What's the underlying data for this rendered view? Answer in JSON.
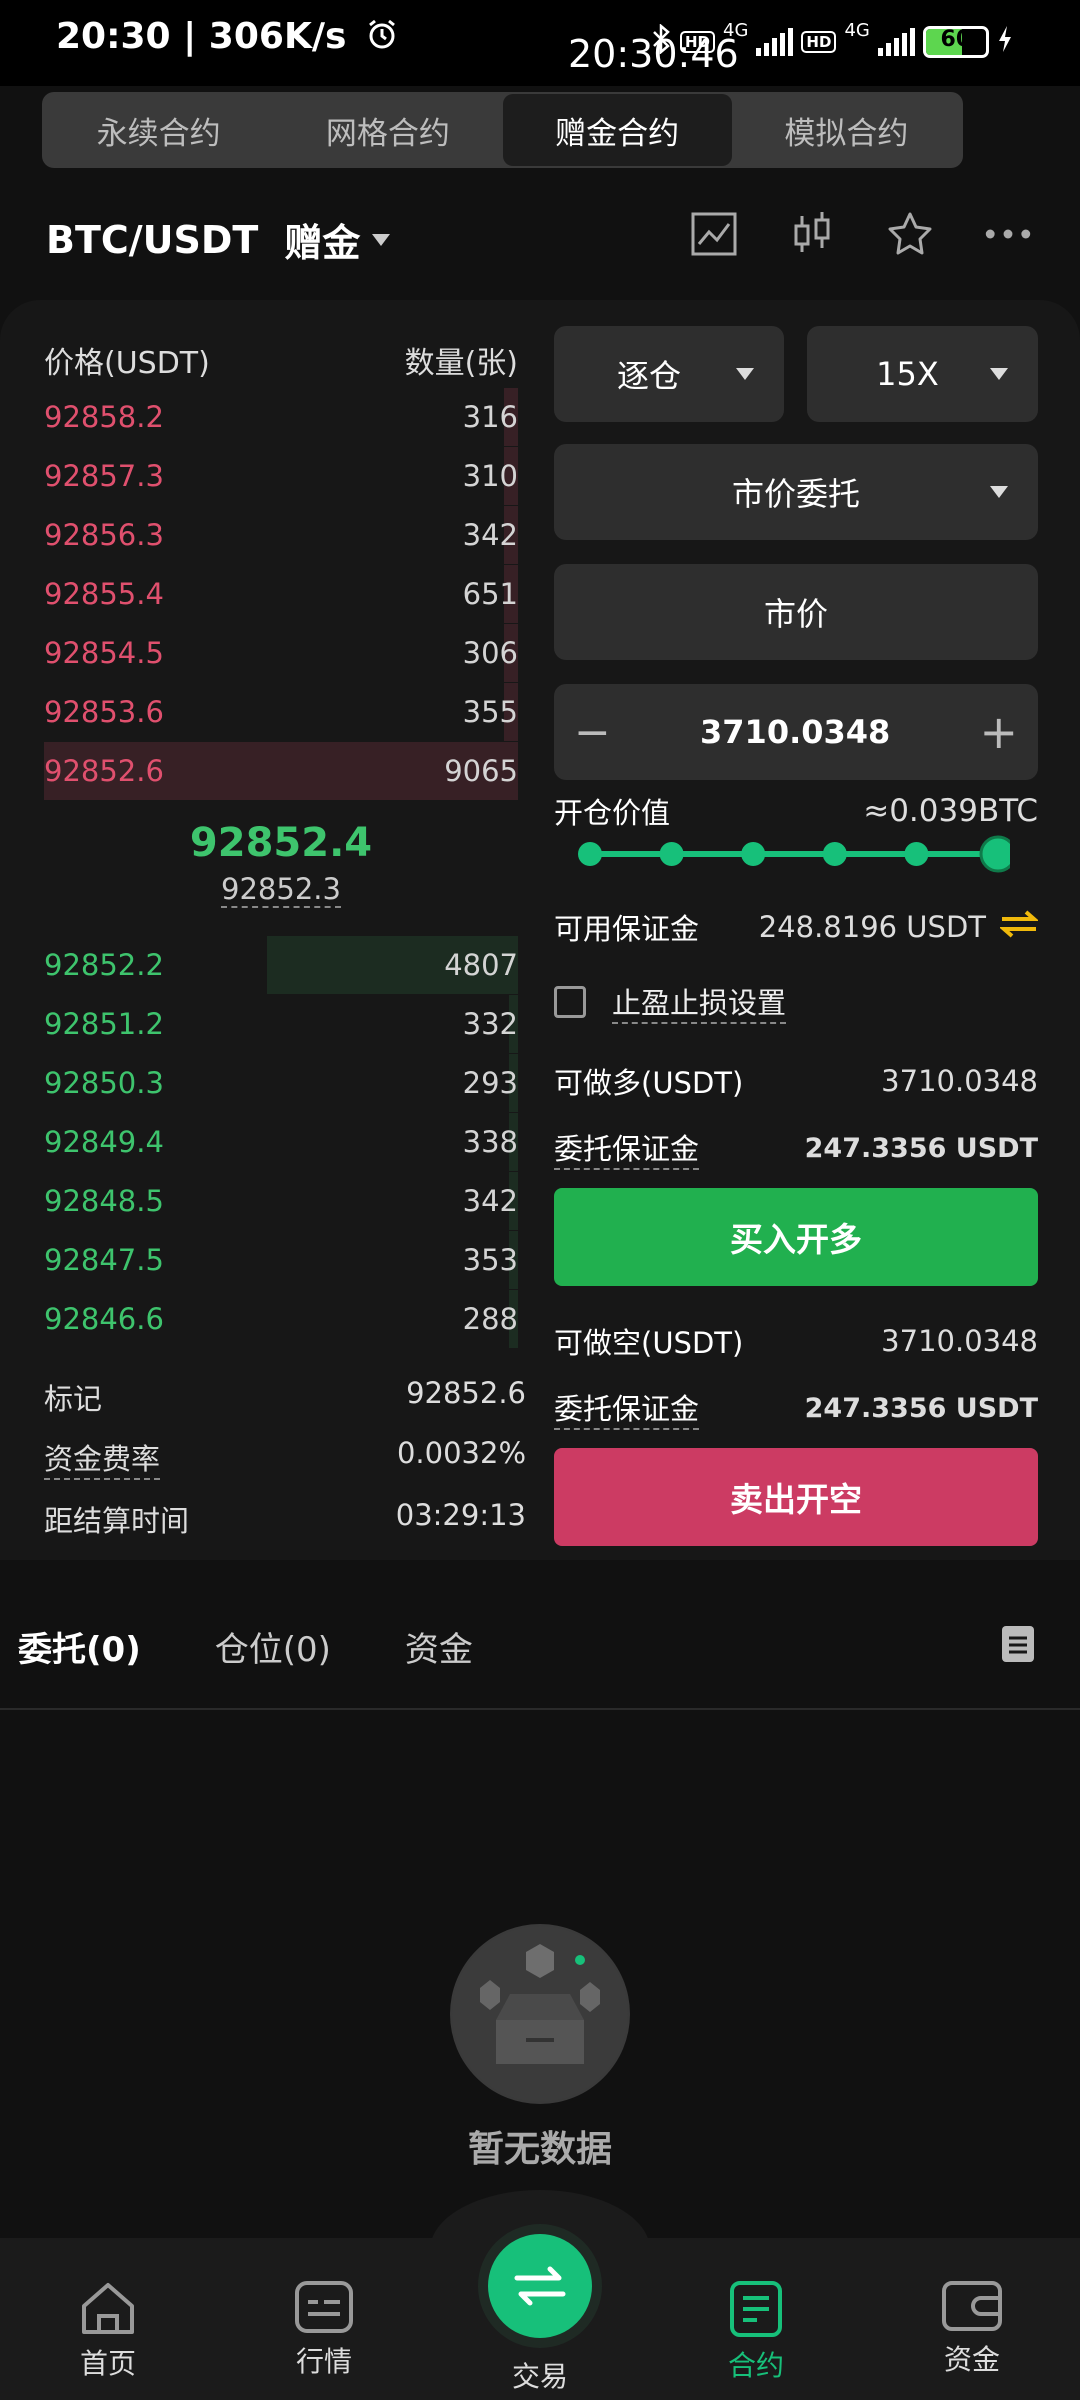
{
  "status_bar": {
    "time_speed": "20:30 | 306K/s",
    "clock": "20:30:46",
    "network_1": "4G",
    "network_2": "4G",
    "hd": "HD",
    "battery": "60",
    "battery_level_percent": 60
  },
  "top_tabs": [
    {
      "label": "永续合约",
      "active": false
    },
    {
      "label": "网格合约",
      "active": false
    },
    {
      "label": "赠金合约",
      "active": true
    },
    {
      "label": "模拟合约",
      "active": false
    }
  ],
  "header": {
    "pair": "BTC/USDT",
    "mode": "赠金"
  },
  "orderbook": {
    "price_header": "价格(USDT)",
    "qty_header": "数量(张)",
    "asks": [
      {
        "price": "92858.2",
        "qty": "316",
        "depth": 0.03
      },
      {
        "price": "92857.3",
        "qty": "310",
        "depth": 0.03
      },
      {
        "price": "92856.3",
        "qty": "342",
        "depth": 0.03
      },
      {
        "price": "92855.4",
        "qty": "651",
        "depth": 0.03
      },
      {
        "price": "92854.5",
        "qty": "306",
        "depth": 0.03
      },
      {
        "price": "92853.6",
        "qty": "355",
        "depth": 0.03
      },
      {
        "price": "92852.6",
        "qty": "9065",
        "depth": 1.0
      }
    ],
    "last_price": "92852.4",
    "mark_price": "92852.3",
    "bids": [
      {
        "price": "92852.2",
        "qty": "4807",
        "depth": 0.53
      },
      {
        "price": "92851.2",
        "qty": "332",
        "depth": 0.02
      },
      {
        "price": "92850.3",
        "qty": "293",
        "depth": 0.02
      },
      {
        "price": "92849.4",
        "qty": "338",
        "depth": 0.02
      },
      {
        "price": "92848.5",
        "qty": "342",
        "depth": 0.02
      },
      {
        "price": "92847.5",
        "qty": "353",
        "depth": 0.02
      },
      {
        "price": "92846.6",
        "qty": "288",
        "depth": 0.02
      }
    ]
  },
  "info": {
    "mark_label": "标记",
    "mark_value": "92852.6",
    "funding_label": "资金费率",
    "funding_value": "0.0032%",
    "settle_label": "距结算时间",
    "settle_value": "03:29:13"
  },
  "form": {
    "margin_mode": "逐仓",
    "leverage": "15X",
    "order_type": "市价委托",
    "price_field": "市价",
    "amount": "3710.0348",
    "minus": "−",
    "plus": "+",
    "open_value_label": "开仓价值",
    "open_value": "≈0.039BTC",
    "slider_steps": 6,
    "slider_level": 1.0,
    "available_label": "可用保证金",
    "available_value": "248.8196 USDT",
    "tpsl_label": "止盈止损设置",
    "long_label": "可做多(USDT)",
    "long_value": "3710.0348",
    "long_margin_label": "委托保证金",
    "long_margin_value": "247.3356 USDT",
    "buy_button": "买入开多",
    "short_label": "可做空(USDT)",
    "short_value": "3710.0348",
    "short_margin_label": "委托保证金",
    "short_margin_value": "247.3356 USDT",
    "sell_button": "卖出开空"
  },
  "bottom_tabs": [
    {
      "label": "委托(0)",
      "active": true
    },
    {
      "label": "仓位(0)",
      "active": false
    },
    {
      "label": "资金",
      "active": false
    }
  ],
  "empty_text": "暂无数据",
  "nav": [
    {
      "label": "首页",
      "icon": "home-icon"
    },
    {
      "label": "行情",
      "icon": "market-icon"
    },
    {
      "label": "交易",
      "icon": "trade-icon"
    },
    {
      "label": "合约",
      "icon": "contract-icon"
    },
    {
      "label": "资金",
      "icon": "wallet-icon"
    }
  ],
  "colors": {
    "bg": "#111111",
    "panel": "#171717",
    "green": "#3ec46d",
    "red": "#e0506e",
    "buy_button": "#21b04f",
    "sell_button": "#cc3b63",
    "accent": "#17c07a",
    "swap_icon": "#f0b90b"
  }
}
